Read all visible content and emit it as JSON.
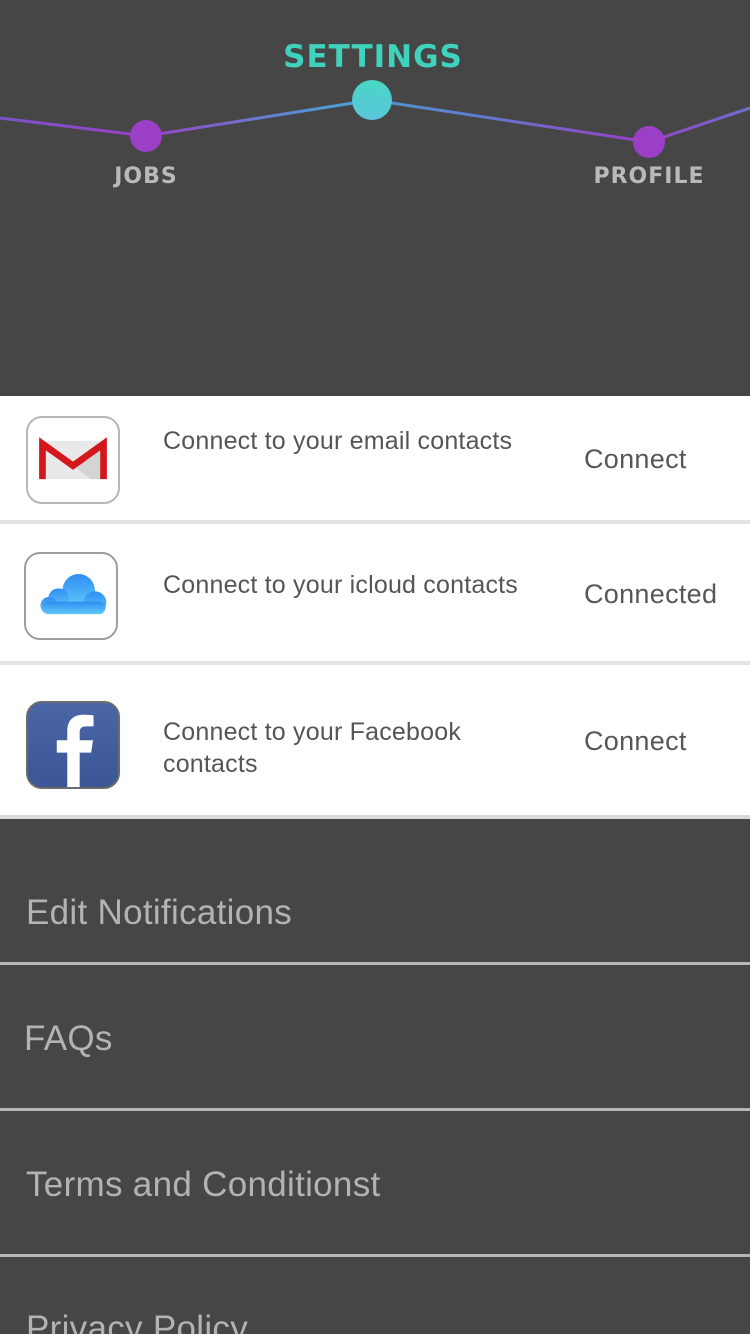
{
  "nav": {
    "items": [
      {
        "label": "JOBS",
        "active": false
      },
      {
        "label": "SETTINGS",
        "active": true
      },
      {
        "label": "PROFILE",
        "active": false
      }
    ],
    "colors": {
      "active_label": "#3fd2bc",
      "inactive_label": "#b9b9b9",
      "dot_inactive": "#9b3fc6",
      "dot_active": "#4fcfd0",
      "line_gradient_start": "#9b3fc6",
      "line_gradient_mid": "#4a9fd6"
    }
  },
  "connections": [
    {
      "icon": "gmail-icon",
      "description": "Connect to your email contacts",
      "action": "Connect"
    },
    {
      "icon": "icloud-icon",
      "description": "Connect to your icloud contacts",
      "action": "Connected"
    },
    {
      "icon": "facebook-icon",
      "description": "Connect to your Facebook contacts",
      "action": "Connect"
    }
  ],
  "menu": {
    "items": [
      {
        "label": "Edit Notifications"
      },
      {
        "label": "FAQs"
      },
      {
        "label": "Terms and Conditionst"
      },
      {
        "label": "Privacy Policy"
      }
    ]
  }
}
